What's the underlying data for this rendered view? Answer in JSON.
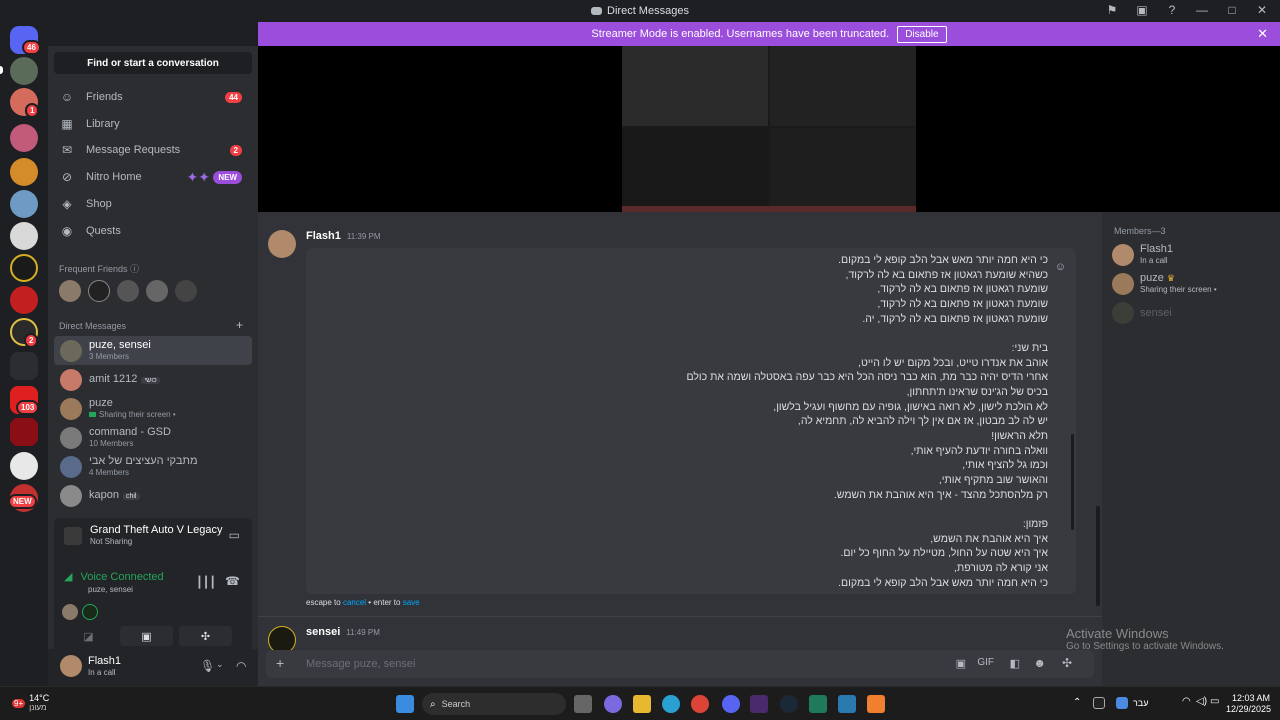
{
  "window": {
    "title": "Direct Messages"
  },
  "banner": {
    "text": "Streamer Mode is enabled. Usernames have been truncated.",
    "button": "Disable"
  },
  "rail": {
    "badges": [
      "46",
      "1",
      "2",
      "103"
    ],
    "new_label": "NEW"
  },
  "sidebar": {
    "find": "Find or start a conversation",
    "nav": [
      {
        "label": "Friends",
        "badge": "44",
        "icon": "friends-icon"
      },
      {
        "label": "Library",
        "icon": "library-icon"
      },
      {
        "label": "Message Requests",
        "badge": "2",
        "icon": "mail-icon"
      },
      {
        "label": "Nitro Home",
        "tag": "NEW",
        "icon": "nitro-icon"
      },
      {
        "label": "Shop",
        "icon": "shop-icon"
      },
      {
        "label": "Quests",
        "icon": "quests-icon"
      }
    ],
    "frequent_label": "Frequent Friends",
    "dm_label": "Direct Messages",
    "dms": [
      {
        "name": "puze, sensei",
        "sub": "3 Members",
        "selected": true
      },
      {
        "name": "amit 1212",
        "tag": "כושי"
      },
      {
        "name": "puze",
        "sub": "Sharing their screen •"
      },
      {
        "name": "command - GSD",
        "sub": "10 Members"
      },
      {
        "name": "מתבקי העציצים של אבי",
        "sub": "4 Members"
      },
      {
        "name": "kapon",
        "tag": "chil"
      }
    ]
  },
  "activity": {
    "game": "Grand Theft Auto V Legacy",
    "game_sub": "Not Sharing",
    "voice": "Voice Connected",
    "voice_sub": "puze, sensei"
  },
  "user": {
    "name": "Flash1",
    "status": "In a call"
  },
  "chat": {
    "msg1_author": "Flash1",
    "msg1_time": "11:39 PM",
    "lines": [
      "כי היא חמה יותר מאש אבל הלב קופא לי במקום.",
      "כשהיא שומעת רגאטון אז פתאום בא לה לרקוד,",
      "שומעת רגאטון אז פתאום בא לה לרקוד,",
      "שומעת רגאטון אז פתאום בא לה לרקוד,",
      "שומעת רגאטון אז פתאום בא לה לרקוד, יה.",
      "",
      "בית שני:",
      "אוהב את אנדרו טייט, ובכל מקום יש לו הייט,",
      "אחרי הדיס יהיה כבר מת, הוא כבר ניסה הכל היא כבר עפה באסטלה ושמה את כולם",
      "בכיס של הג'ינס שראינו ת'תחתון,",
      "לא הולכת לישון, לא רואה באישון, גופיה עם מחשוף ועגיל בלשון,",
      "יש לה לב מבטון, אז אם אין לך וילה להביא לה, תחמיא לה,",
      "תלא הראשון!",
      "וואלה בחורה יודעת להעיף אותי,",
      "וכמו גל להציף אותי,",
      "והאושר שוב מתקיף אותי,",
      "רק מלהסתכל מהצד - איך היא אוהבת את השמש.",
      "",
      "פזמון:",
      "איך היא אוהבת את השמש,",
      "איך היא שטה על החול, מטיילת על החוף כל יום.",
      "אני קורא לה מטורפת,",
      "כי היא חמה יותר מאש אבל הלב קופא לי במקום."
    ],
    "edit_note_pre": "escape to",
    "edit_cancel": "cancel",
    "edit_mid": "• enter to",
    "edit_save": "save",
    "msg2_author": "sensei",
    "msg2_time": "11:49 PM",
    "composer_placeholder": "Message puze, sensei"
  },
  "members": {
    "header": "Members—3",
    "list": [
      {
        "name": "Flash1",
        "sub": "In a call"
      },
      {
        "name": "puze",
        "sub": "Sharing their screen •"
      },
      {
        "name": "sensei",
        "sub": ""
      }
    ]
  },
  "watermark": {
    "line1": "Activate Windows",
    "line2": "Go to Settings to activate Windows."
  },
  "taskbar": {
    "weather_temp": "14°C",
    "weather_desc": "מעונן",
    "weather_badge": "9+",
    "search": "Search",
    "lang": "עבר",
    "time": "12:03 AM",
    "date": "12/29/2025"
  }
}
